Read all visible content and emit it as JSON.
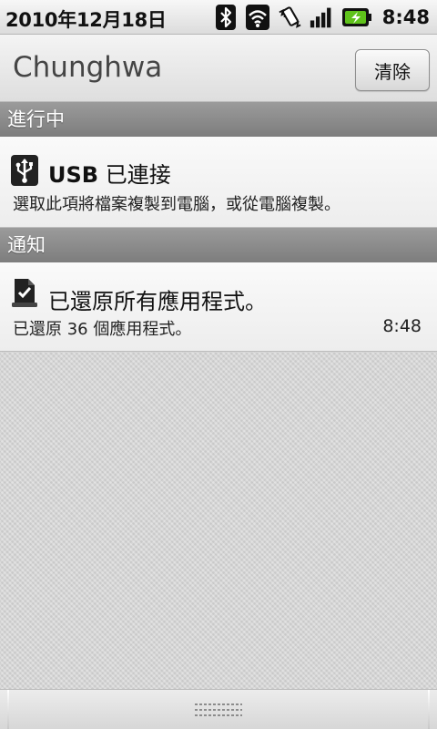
{
  "status_bar": {
    "date": "2010年12月18日",
    "time": "8:48",
    "icons": [
      "bluetooth-icon",
      "wifi-icon",
      "vibrate-icon",
      "signal-icon",
      "battery-charging-icon"
    ]
  },
  "header": {
    "carrier": "Chunghwa",
    "clear_button": "清除"
  },
  "sections": {
    "ongoing": "進行中",
    "notifications": "通知"
  },
  "ongoing_items": [
    {
      "icon": "usb-icon",
      "title_bold": "USB",
      "title_rest": " 已連接",
      "text": "選取此項將檔案複製到電腦，或從電腦複製。"
    }
  ],
  "notification_items": [
    {
      "icon": "restore-complete-icon",
      "title": "已還原所有應用程式。",
      "text": "已還原 36 個應用程式。",
      "time": "8:48"
    }
  ],
  "colors": {
    "section_header": "#8a8a8a",
    "item_background": "#f4f4f4",
    "panel_background": "#d6d6d6"
  }
}
